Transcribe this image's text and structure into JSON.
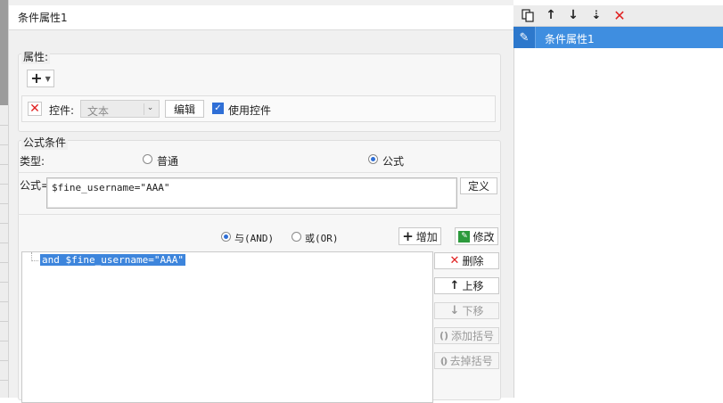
{
  "dialog": {
    "title": "条件属性1"
  },
  "attributes": {
    "section_label": "属性:",
    "add_label": "+",
    "control_label": "控件:",
    "control_type_value": "文本",
    "edit_button": "编辑",
    "use_control_label": "使用控件",
    "use_control_checked": true
  },
  "formula_section": {
    "section_label": "公式条件",
    "type_label": "类型:",
    "type_options": [
      {
        "label": "普通",
        "selected": false
      },
      {
        "label": "公式",
        "selected": true
      }
    ],
    "formula_label": "公式=",
    "formula_value": "$fine_username=\"AAA\"",
    "define_button": "定义",
    "logic_options": [
      {
        "label": "与(AND)",
        "selected": true
      },
      {
        "label": "或(OR)",
        "selected": false
      }
    ],
    "add_button": "增加",
    "modify_button": "修改",
    "conditions": [
      "and $fine_username=\"AAA\""
    ],
    "side_buttons": {
      "delete": "删除",
      "move_up": "上移",
      "move_down": "下移",
      "add_brackets": "添加括号",
      "remove_brackets": "去掉括号"
    }
  },
  "right_panel": {
    "toolbar_icons": [
      "copy-icon",
      "arrow-up-icon",
      "arrow-down-icon",
      "move-to-bottom-icon",
      "delete-icon"
    ],
    "items": [
      {
        "label": "条件属性1",
        "selected": true
      }
    ]
  },
  "colors": {
    "accent": "#3f8ee0",
    "selection": "#3d85dc",
    "delete_red": "#e02020",
    "modify_green": "#2c9a3c"
  }
}
